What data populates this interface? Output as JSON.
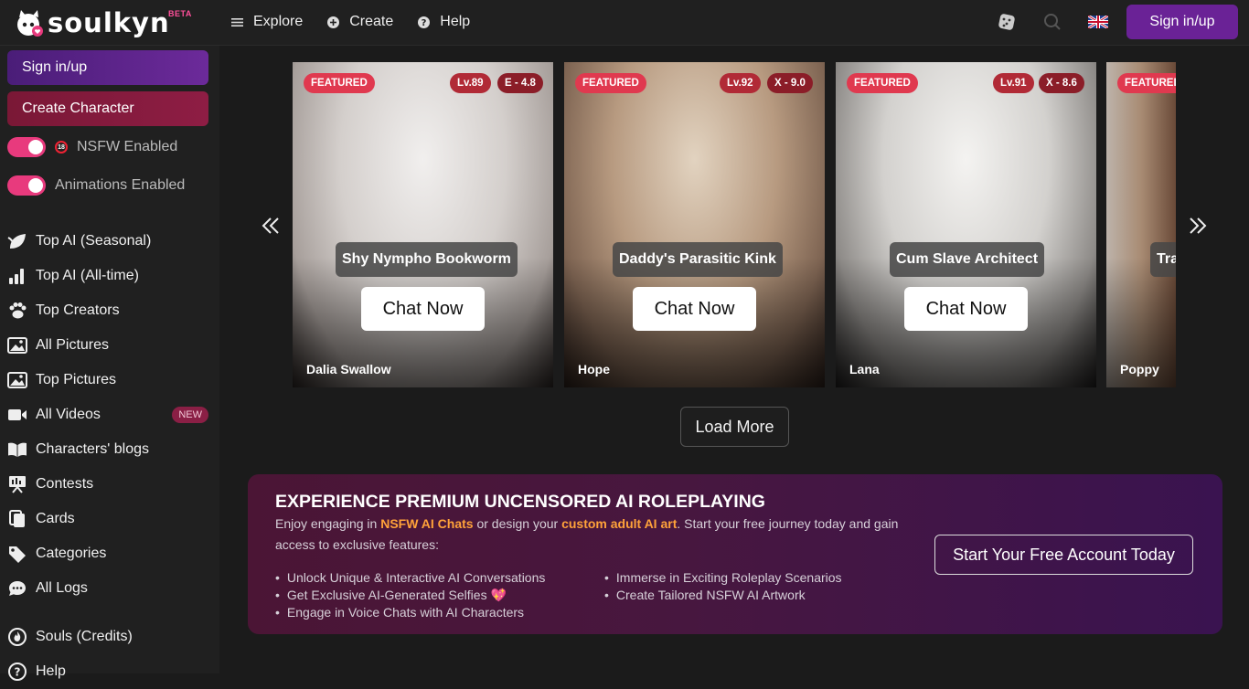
{
  "brand": {
    "name": "soulkyn",
    "tag": "BETA"
  },
  "nav": [
    {
      "label": "Explore",
      "icon": "menu-lines-icon"
    },
    {
      "label": "Create",
      "icon": "plus-circle-icon"
    },
    {
      "label": "Help",
      "icon": "question-circle-icon"
    }
  ],
  "header": {
    "signin_label": "Sign in/up"
  },
  "sidebar": {
    "signin_label": "Sign in/up",
    "create_label": "Create Character",
    "toggles": [
      {
        "label": "NSFW Enabled",
        "badge": "18",
        "on": true
      },
      {
        "label": "Animations Enabled",
        "on": true
      }
    ],
    "items": [
      {
        "label": "Top AI (Seasonal)",
        "icon": "leaf-icon"
      },
      {
        "label": "Top AI (All-time)",
        "icon": "bar-chart-icon"
      },
      {
        "label": "Top Creators",
        "icon": "paw-icon"
      },
      {
        "label": "All Pictures",
        "icon": "image-icon"
      },
      {
        "label": "Top Pictures",
        "icon": "image-icon"
      },
      {
        "label": "All Videos",
        "icon": "video-icon",
        "badge": "NEW"
      },
      {
        "label": "Characters' blogs",
        "icon": "book-icon"
      },
      {
        "label": "Contests",
        "icon": "presentation-icon"
      },
      {
        "label": "Cards",
        "icon": "cards-icon"
      },
      {
        "label": "Categories",
        "icon": "tag-icon"
      },
      {
        "label": "All Logs",
        "icon": "chat-bubble-icon"
      }
    ],
    "bottom": [
      {
        "label": "Souls (Credits)",
        "icon": "fire-icon"
      },
      {
        "label": "Help",
        "icon": "question-circle-icon"
      }
    ]
  },
  "cards": [
    {
      "featured": "FEATURED",
      "level": "Lv.89",
      "score": "E - 4.8",
      "title": "Shy Nympho Bookworm",
      "cta": "Chat Now",
      "name": "Dalia Swallow",
      "colors": [
        "#d9d6d4",
        "#b7b0ad",
        "#2a2422"
      ]
    },
    {
      "featured": "FEATURED",
      "level": "Lv.92",
      "score": "X - 9.0",
      "title": "Daddy's Parasitic Kink",
      "cta": "Chat Now",
      "name": "Hope",
      "colors": [
        "#cfb9a0",
        "#9b7f68",
        "#2b1f1a"
      ]
    },
    {
      "featured": "FEATURED",
      "level": "Lv.91",
      "score": "X - 8.6",
      "title": "Cum Slave Architect",
      "cta": "Chat Now",
      "name": "Lana",
      "colors": [
        "#e8e6e3",
        "#a9a6a2",
        "#1d1c1c"
      ]
    },
    {
      "featured": "FEATURED",
      "level": "",
      "score": "",
      "title": "Tra",
      "cta": "",
      "name": "Poppy",
      "colors": [
        "#a89d94",
        "#7a5a48",
        "#2a201b"
      ]
    }
  ],
  "load_more": "Load More",
  "promo": {
    "title": "EXPERIENCE PREMIUM UNCENSORED AI ROLEPLAYING",
    "text_a": "Enjoy engaging in ",
    "hl_a": "NSFW AI Chats",
    "text_b": " or design your ",
    "hl_b": "custom adult AI art",
    "text_c": ". Start your free journey today and gain access to exclusive features:",
    "bullets_left": [
      "Unlock Unique & Interactive AI Conversations",
      "Get Exclusive AI-Generated Selfies 💖",
      "Engage in Voice Chats with AI Characters"
    ],
    "bullets_right": [
      "Immerse in Exciting Roleplay Scenarios",
      "Create Tailored NSFW AI Artwork"
    ],
    "cta": "Start Your Free Account Today"
  },
  "colors": {
    "accent_purple": "#6a2296",
    "accent_red": "#8e1d44",
    "toggle_pink": "#e83a7d",
    "highlight_orange": "#ffa23a"
  }
}
